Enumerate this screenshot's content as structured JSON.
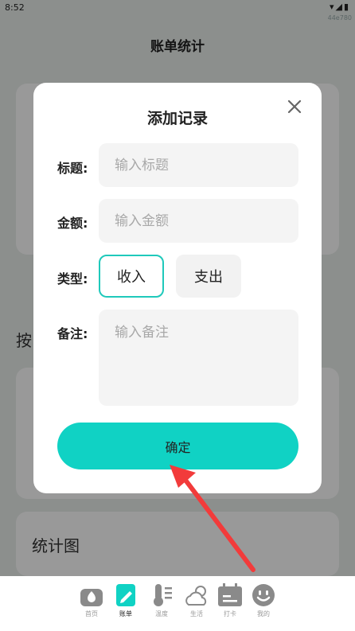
{
  "status_bar": {
    "time": "8:52",
    "build_tag": "44e780"
  },
  "header": {
    "title": "账单统计"
  },
  "background": {
    "section_title_partial": "按",
    "card3_title": "统计图"
  },
  "dialog": {
    "title": "添加记录",
    "fields": {
      "title": {
        "label": "标题:",
        "placeholder": "输入标题"
      },
      "amount": {
        "label": "金额:",
        "placeholder": "输入金额"
      },
      "type": {
        "label": "类型:",
        "options": [
          "收入",
          "支出"
        ],
        "selected": "收入"
      },
      "note": {
        "label": "备注:",
        "placeholder": "输入备注"
      }
    },
    "confirm_label": "确定"
  },
  "tabbar": {
    "items": [
      {
        "label": "首页",
        "icon": "home-icon"
      },
      {
        "label": "账单",
        "icon": "bill-icon",
        "active": true
      },
      {
        "label": "温度",
        "icon": "thermometer-icon"
      },
      {
        "label": "生活",
        "icon": "weather-icon"
      },
      {
        "label": "打卡",
        "icon": "calendar-icon"
      },
      {
        "label": "我的",
        "icon": "smile-icon"
      }
    ]
  },
  "colors": {
    "accent": "#10d2c4",
    "selected_border": "#1fc9bb",
    "annotation_arrow": "#f23b3b",
    "tab_icon_gray": "#8a8a8a"
  }
}
